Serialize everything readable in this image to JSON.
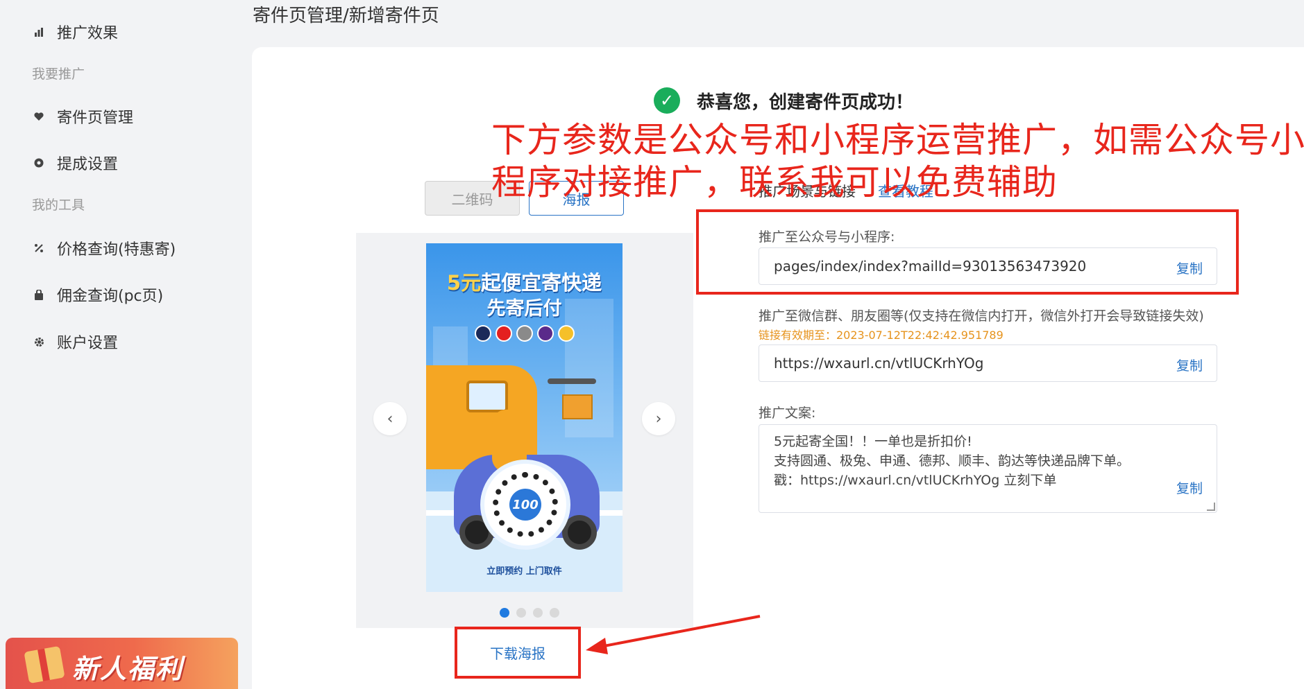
{
  "sidebar": {
    "items": [
      {
        "label": "推广效果",
        "icon": "bar-chart-icon"
      },
      {
        "label": "寄件页管理",
        "icon": "heart-hand-icon"
      },
      {
        "label": "提成设置",
        "icon": "coin-icon"
      },
      {
        "label": "价格查询(特惠寄)",
        "icon": "percent-icon"
      },
      {
        "label": "佣金查询(pc页)",
        "icon": "bag-icon"
      },
      {
        "label": "账户设置",
        "icon": "gear-icon"
      }
    ],
    "groups": [
      "我要推广",
      "我的工具"
    ],
    "promo": {
      "label": "新人福利"
    }
  },
  "breadcrumb": "寄件页管理/新增寄件页",
  "success": {
    "message": "恭喜您，创建寄件页成功！"
  },
  "tabs": [
    {
      "label": "二维码",
      "active": false
    },
    {
      "label": "海报",
      "active": true
    }
  ],
  "poster": {
    "title_highlight": "5元",
    "title_rest": "起便宜寄快递",
    "subtitle": "先寄后付",
    "badge": "100",
    "footer": "立即预约 上门取件",
    "dots_total": 4,
    "dots_active": 0
  },
  "download_label": "下载海报",
  "section": {
    "title": "推广场景与链接",
    "tutorial_link": "查看教程"
  },
  "fields": {
    "miniprogram": {
      "label": "推广至公众号与小程序:",
      "value": "pages/index/index?mailId=93013563473920",
      "copy_label": "复制"
    },
    "wechat": {
      "label": "推广至微信群、朋友圈等(仅支持在微信内打开，微信外打开会导致链接失效)",
      "expiry": "链接有效期至：2023-07-12T22:42:42.951789",
      "value": "https://wxaurl.cn/vtlUCKrhYOg",
      "copy_label": "复制"
    },
    "copywriting": {
      "label": "推广文案:",
      "lines": [
        "5元起寄全国！！一单也是折扣价!",
        "支持圆通、极兔、申通、德邦、顺丰、韵达等快递品牌下单。",
        "戳：https://wxaurl.cn/vtlUCKrhYOg 立刻下单"
      ],
      "copy_label": "复制"
    }
  },
  "annotation": {
    "line1": "下方参数是公众号和小程序运营推广，如需公众号小",
    "line2": "程序对接推广，联系我可以免费辅助",
    "color": "#e8261c"
  }
}
